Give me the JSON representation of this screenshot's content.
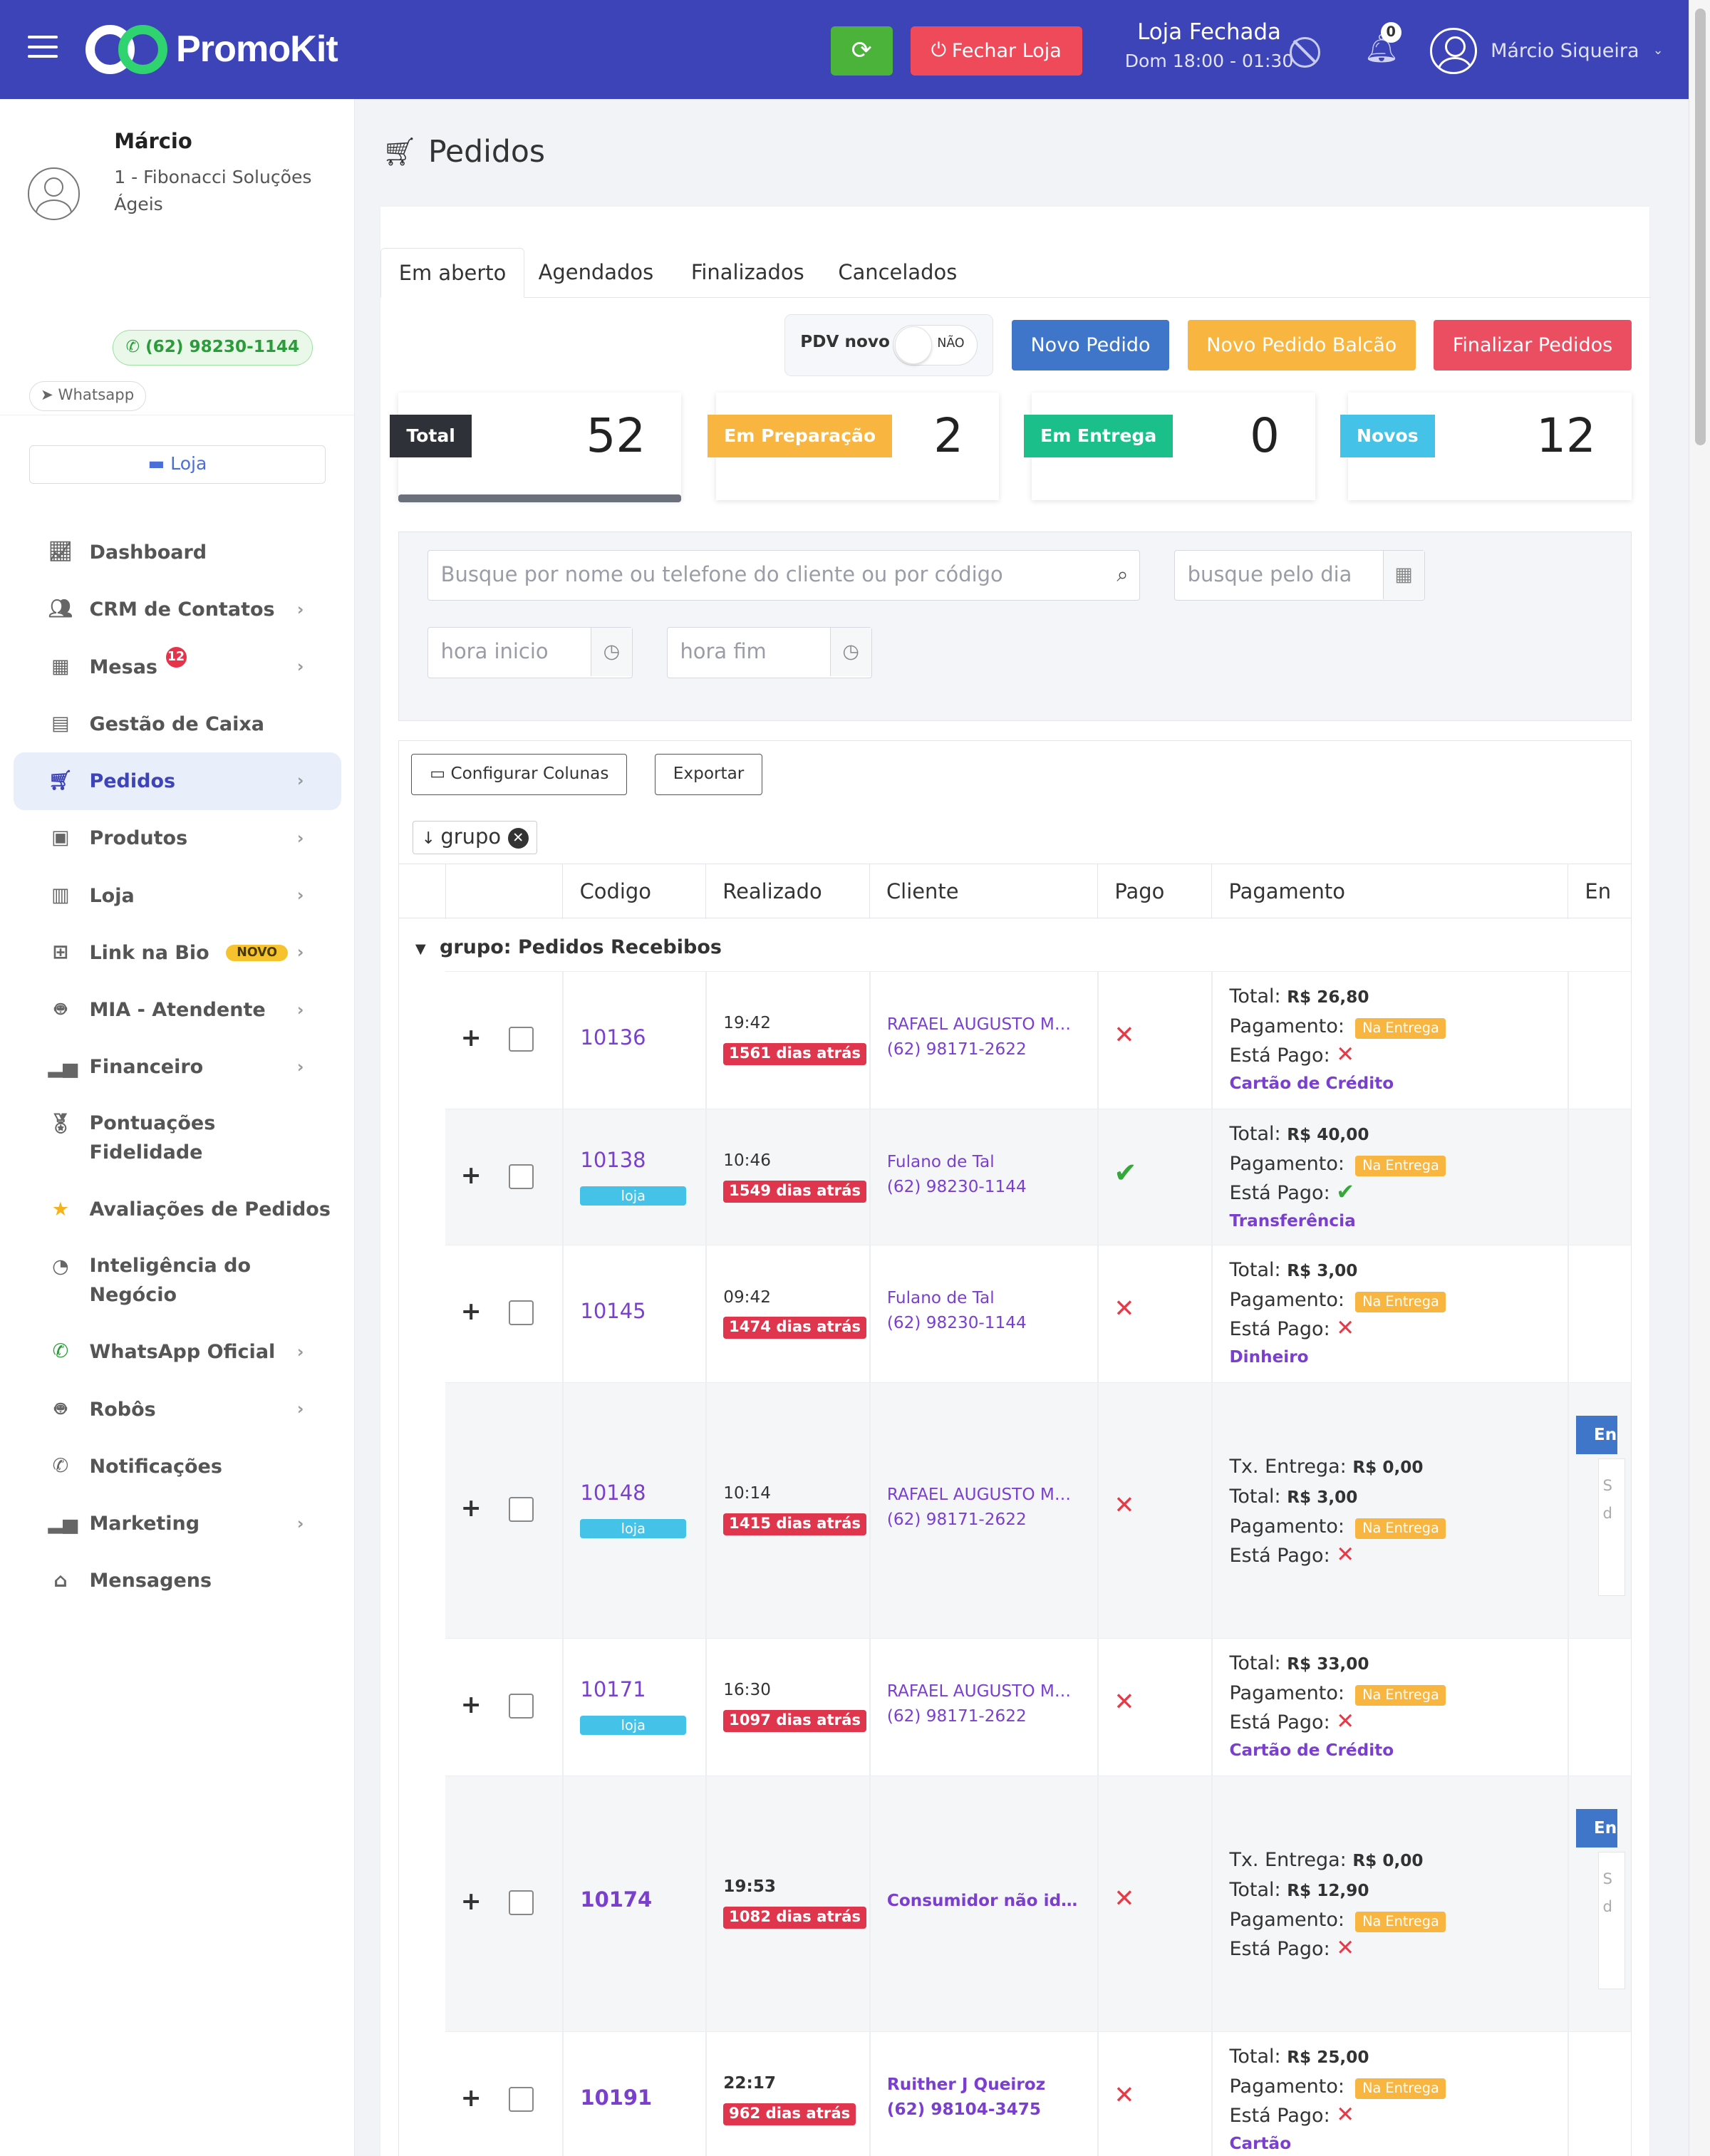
{
  "header": {
    "brand": "PromoKit",
    "close_label": "Fechar Loja",
    "store_status": "Loja Fechada",
    "store_hours": "Dom 18:00 - 01:30",
    "notifications": "0",
    "user_name": "Márcio Siqueira"
  },
  "profile": {
    "name": "Márcio",
    "company": "1 - Fibonacci Soluções Ágeis",
    "phone": "(62) 98230-1144",
    "whatsapp": "Whatsapp",
    "store": "Loja"
  },
  "nav": [
    {
      "label": "Dashboard",
      "icon": "chart-line-icon"
    },
    {
      "label": "CRM de Contatos",
      "icon": "users-icon"
    },
    {
      "label": "Mesas",
      "icon": "table-icon",
      "badge": "12"
    },
    {
      "label": "Gestão de Caixa",
      "icon": "cash-register-icon"
    },
    {
      "label": "Pedidos",
      "icon": "cart-icon"
    },
    {
      "label": "Produtos",
      "icon": "boxes-icon"
    },
    {
      "label": "Loja",
      "icon": "building-icon"
    },
    {
      "label": "Link na Bio",
      "icon": "sitemap-icon",
      "tag": "NOVO"
    },
    {
      "label": "MIA - Atendente",
      "icon": "robot-icon"
    },
    {
      "label": "Financeiro",
      "icon": "bar-chart-icon"
    },
    {
      "label": "Pontuações Fidelidade",
      "icon": "medal-icon"
    },
    {
      "label": "Avaliações de Pedidos",
      "icon": "star-icon"
    },
    {
      "label": "Inteligência do Negócio",
      "icon": "pie-chart-icon"
    },
    {
      "label": "WhatsApp Oficial",
      "icon": "whatsapp-icon"
    },
    {
      "label": "Robôs",
      "icon": "robot-icon"
    },
    {
      "label": "Notificações",
      "icon": "whatsapp-icon"
    },
    {
      "label": "Marketing",
      "icon": "bar-chart-icon"
    },
    {
      "label": "Mensagens",
      "icon": "inbox-icon"
    }
  ],
  "page": {
    "title": "Pedidos"
  },
  "tabs": [
    "Em aberto",
    "Agendados",
    "Finalizados",
    "Cancelados"
  ],
  "pdv": {
    "label": "PDV novo",
    "toggle": "NÃO"
  },
  "actions": {
    "new_order": "Novo Pedido",
    "new_counter": "Novo Pedido Balcão",
    "finish": "Finalizar Pedidos"
  },
  "stats": [
    {
      "label": "Total",
      "value": "52",
      "color": "#2f3138"
    },
    {
      "label": "Em Preparação",
      "value": "2",
      "color": "#f8b53f"
    },
    {
      "label": "Em Entrega",
      "value": "0",
      "color": "#1bbf8a"
    },
    {
      "label": "Novos",
      "value": "12",
      "color": "#45c2e8"
    }
  ],
  "filters": {
    "search_placeholder": "Busque por nome ou telefone do cliente ou por código",
    "day_placeholder": "busque pelo dia",
    "start_placeholder": "hora inicio",
    "end_placeholder": "hora fim"
  },
  "grid": {
    "configure": "Configurar Colunas",
    "export": "Exportar",
    "group_chip": "grupo",
    "columns": [
      "Codigo",
      "Realizado",
      "Cliente",
      "Pago",
      "Pagamento",
      "En"
    ],
    "group_title": "grupo: Pedidos Recebibos"
  },
  "orders": [
    {
      "code": "10136",
      "time": "19:42",
      "ago": "1561 dias atrás",
      "client": "RAFAEL AUGUSTO ME...",
      "phone": "(62) 98171-2622",
      "paid": false,
      "fee": "",
      "total": "R$ 26,80",
      "pay_status": "Na Entrega",
      "method": "Cartão de Crédito"
    },
    {
      "code": "10138",
      "tag": "loja",
      "time": "10:46",
      "ago": "1549 dias atrás",
      "client": "Fulano de Tal",
      "phone": "(62) 98230-1144",
      "paid": true,
      "fee": "",
      "total": "R$ 40,00",
      "pay_status": "Na Entrega",
      "method": "Transferência"
    },
    {
      "code": "10145",
      "time": "09:42",
      "ago": "1474 dias atrás",
      "client": "Fulano de Tal",
      "phone": "(62) 98230-1144",
      "paid": false,
      "fee": "",
      "total": "R$ 3,00",
      "pay_status": "Na Entrega",
      "method": "Dinheiro"
    },
    {
      "code": "10148",
      "tag": "loja",
      "time": "10:14",
      "ago": "1415 dias atrás",
      "client": "RAFAEL AUGUSTO ME...",
      "phone": "(62) 98171-2622",
      "paid": false,
      "fee": "R$ 0,00",
      "total": "R$ 3,00",
      "pay_status": "Na Entrega",
      "method": ""
    },
    {
      "code": "10171",
      "tag": "loja",
      "time": "16:30",
      "ago": "1097 dias atrás",
      "client": "RAFAEL AUGUSTO ME...",
      "phone": "(62) 98171-2622",
      "paid": false,
      "fee": "",
      "total": "R$ 33,00",
      "pay_status": "Na Entrega",
      "method": "Cartão de Crédito"
    },
    {
      "code": "10174",
      "time": "19:53",
      "ago": "1082 dias atrás",
      "client": "Consumidor não ide...",
      "phone": "",
      "paid": false,
      "fee": "R$ 0,00",
      "total": "R$ 12,90",
      "pay_status": "Na Entrega",
      "method": ""
    },
    {
      "code": "10191",
      "time": "22:17",
      "ago": "962 dias atrás",
      "client": "Ruither J Queiroz",
      "phone": "(62) 98104-3475",
      "paid": false,
      "fee": "",
      "total": "R$ 25,00",
      "pay_status": "Na Entrega",
      "method": "Cartão"
    }
  ],
  "labels": {
    "total": "Total:",
    "payment": "Pagamento:",
    "is_paid": "Está Pago:",
    "fee": "Tx. Entrega:"
  },
  "partial": {
    "entr": "En",
    "entr_lines": [
      "S",
      "d"
    ]
  }
}
